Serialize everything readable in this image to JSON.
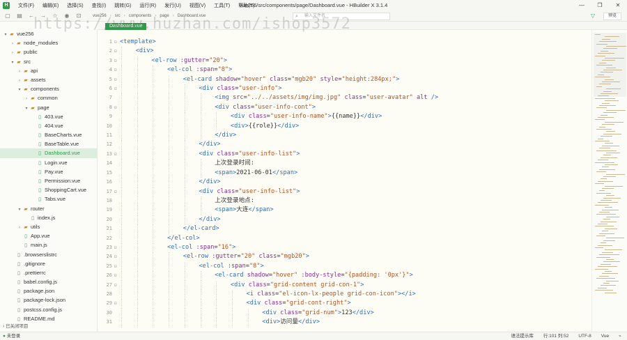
{
  "window": {
    "title": "vue256/src/components/page/Dashboard.vue - HBuilder X 3.1.4",
    "logo": "H",
    "controls": [
      "—",
      "❐",
      "✕"
    ]
  },
  "menu": [
    "文件(F)",
    "编辑(E)",
    "选择(S)",
    "查找(I)",
    "跳转(G)",
    "运行(R)",
    "发行(U)",
    "视图(V)",
    "工具(T)",
    "帮助(Y)"
  ],
  "toolbar": {
    "breadcrumbs": [
      "vue256",
      "src",
      "components",
      "page",
      "Dashboard.vue"
    ],
    "search_placeholder": "输入文件名",
    "preview_label": "预览"
  },
  "watermark": "https://www.huzhan.com/ishop3572",
  "sidebar": {
    "items": [
      {
        "label": "vue256",
        "type": "folder",
        "depth": 0,
        "open": true
      },
      {
        "label": "node_modules",
        "type": "folder",
        "depth": 1,
        "open": false
      },
      {
        "label": "public",
        "type": "folder",
        "depth": 1,
        "open": false
      },
      {
        "label": "src",
        "type": "folder",
        "depth": 1,
        "open": true
      },
      {
        "label": "api",
        "type": "folder",
        "depth": 2,
        "open": false
      },
      {
        "label": "assets",
        "type": "folder",
        "depth": 2,
        "open": false
      },
      {
        "label": "components",
        "type": "folder",
        "depth": 2,
        "open": true
      },
      {
        "label": "common",
        "type": "folder",
        "depth": 3,
        "open": false
      },
      {
        "label": "page",
        "type": "folder",
        "depth": 3,
        "open": true
      },
      {
        "label": "403.vue",
        "type": "vue",
        "depth": 4
      },
      {
        "label": "404.vue",
        "type": "vue",
        "depth": 4
      },
      {
        "label": "BaseCharts.vue",
        "type": "vue",
        "depth": 4
      },
      {
        "label": "BaseTable.vue",
        "type": "vue",
        "depth": 4
      },
      {
        "label": "Dashboard.vue",
        "type": "vue",
        "depth": 4,
        "selected": true
      },
      {
        "label": "Login.vue",
        "type": "vue",
        "depth": 4
      },
      {
        "label": "Pay.vue",
        "type": "vue",
        "depth": 4
      },
      {
        "label": "Permission.vue",
        "type": "vue",
        "depth": 4
      },
      {
        "label": "ShoppingCart.vue",
        "type": "vue",
        "depth": 4
      },
      {
        "label": "Tabs.vue",
        "type": "vue",
        "depth": 4
      },
      {
        "label": "router",
        "type": "folder",
        "depth": 2,
        "open": true
      },
      {
        "label": "index.js",
        "type": "file",
        "depth": 3
      },
      {
        "label": "utils",
        "type": "folder",
        "depth": 2,
        "open": false
      },
      {
        "label": "App.vue",
        "type": "vue",
        "depth": 2
      },
      {
        "label": "main.js",
        "type": "file",
        "depth": 2
      },
      {
        "label": ".browserslistrc",
        "type": "file",
        "depth": 1
      },
      {
        "label": ".gitignore",
        "type": "file",
        "depth": 1
      },
      {
        "label": ".prettierrc",
        "type": "file",
        "depth": 1
      },
      {
        "label": "babel.config.js",
        "type": "file",
        "depth": 1
      },
      {
        "label": "package.json",
        "type": "file",
        "depth": 1
      },
      {
        "label": "package-lock.json",
        "type": "file",
        "depth": 1
      },
      {
        "label": "postcss.config.js",
        "type": "file",
        "depth": 1
      },
      {
        "label": "README.md",
        "type": "file",
        "depth": 1
      }
    ],
    "footer": "已关闭项目"
  },
  "editor": {
    "tab_label": "Dashboard.vue",
    "lines": [
      {
        "n": 1,
        "fold": true,
        "indent": 0,
        "parts": [
          [
            "tg",
            "<template>"
          ]
        ]
      },
      {
        "n": 2,
        "fold": true,
        "indent": 1,
        "parts": [
          [
            "tg",
            "<div>"
          ]
        ]
      },
      {
        "n": 3,
        "fold": true,
        "indent": 2,
        "parts": [
          [
            "tg",
            "<el-row "
          ],
          [
            "at",
            ":gutter"
          ],
          [
            "tx",
            "="
          ],
          [
            "st",
            "\"20\""
          ],
          [
            "tg",
            ">"
          ]
        ]
      },
      {
        "n": 4,
        "fold": true,
        "indent": 3,
        "parts": [
          [
            "tg",
            "<el-col "
          ],
          [
            "at",
            ":span"
          ],
          [
            "tx",
            "="
          ],
          [
            "st",
            "\"8\""
          ],
          [
            "tg",
            ">"
          ]
        ]
      },
      {
        "n": 5,
        "fold": true,
        "indent": 4,
        "parts": [
          [
            "tg",
            "<el-card "
          ],
          [
            "at",
            "shadow"
          ],
          [
            "tx",
            "="
          ],
          [
            "st",
            "\"hover\""
          ],
          [
            "at",
            " class"
          ],
          [
            "tx",
            "="
          ],
          [
            "st",
            "\"mgb20\""
          ],
          [
            "at",
            " style"
          ],
          [
            "tx",
            "="
          ],
          [
            "st",
            "\"height:284px;\""
          ],
          [
            "tg",
            ">"
          ]
        ]
      },
      {
        "n": 6,
        "fold": true,
        "indent": 5,
        "parts": [
          [
            "tg",
            "<div "
          ],
          [
            "at",
            "class"
          ],
          [
            "tx",
            "="
          ],
          [
            "st",
            "\"user-info\""
          ],
          [
            "tg",
            ">"
          ]
        ]
      },
      {
        "n": 7,
        "fold": false,
        "indent": 6,
        "parts": [
          [
            "tg",
            "<img "
          ],
          [
            "at",
            "src"
          ],
          [
            "tx",
            "="
          ],
          [
            "st",
            "\"../../assets/img/img.jpg\""
          ],
          [
            "at",
            " class"
          ],
          [
            "tx",
            "="
          ],
          [
            "st",
            "\"user-avatar\""
          ],
          [
            "at",
            " alt"
          ],
          [
            "tg",
            " />"
          ]
        ]
      },
      {
        "n": 8,
        "fold": true,
        "indent": 6,
        "parts": [
          [
            "tg",
            "<div "
          ],
          [
            "at",
            "class"
          ],
          [
            "tx",
            "="
          ],
          [
            "st",
            "\"user-info-cont\""
          ],
          [
            "tg",
            ">"
          ]
        ]
      },
      {
        "n": 9,
        "fold": false,
        "indent": 7,
        "parts": [
          [
            "tg",
            "<div "
          ],
          [
            "at",
            "class"
          ],
          [
            "tx",
            "="
          ],
          [
            "st",
            "\"user-info-name\""
          ],
          [
            "tg",
            ">"
          ],
          [
            "tx",
            "{{name}}"
          ],
          [
            "tg",
            "</div>"
          ]
        ]
      },
      {
        "n": 10,
        "fold": false,
        "indent": 7,
        "parts": [
          [
            "tg",
            "<div>"
          ],
          [
            "tx",
            "{{role}}"
          ],
          [
            "tg",
            "</div>"
          ]
        ]
      },
      {
        "n": 11,
        "fold": false,
        "indent": 6,
        "parts": [
          [
            "tg",
            "</div>"
          ]
        ]
      },
      {
        "n": 12,
        "fold": false,
        "indent": 5,
        "parts": [
          [
            "tg",
            "</div>"
          ]
        ]
      },
      {
        "n": 13,
        "fold": true,
        "indent": 5,
        "parts": [
          [
            "tg",
            "<div "
          ],
          [
            "at",
            "class"
          ],
          [
            "tx",
            "="
          ],
          [
            "st",
            "\"user-info-list\""
          ],
          [
            "tg",
            ">"
          ]
        ]
      },
      {
        "n": 14,
        "fold": false,
        "indent": 6,
        "parts": [
          [
            "tx",
            "上次登录时间:"
          ]
        ]
      },
      {
        "n": 15,
        "fold": false,
        "indent": 6,
        "parts": [
          [
            "tg",
            "<span>"
          ],
          [
            "tx",
            "2021-06-01"
          ],
          [
            "tg",
            "</span>"
          ]
        ]
      },
      {
        "n": 16,
        "fold": false,
        "indent": 5,
        "parts": [
          [
            "tg",
            "</div>"
          ]
        ]
      },
      {
        "n": 17,
        "fold": true,
        "indent": 5,
        "parts": [
          [
            "tg",
            "<div "
          ],
          [
            "at",
            "class"
          ],
          [
            "tx",
            "="
          ],
          [
            "st",
            "\"user-info-list\""
          ],
          [
            "tg",
            ">"
          ]
        ]
      },
      {
        "n": 18,
        "fold": false,
        "indent": 6,
        "parts": [
          [
            "tx",
            "上次登录地点:"
          ]
        ]
      },
      {
        "n": 19,
        "fold": false,
        "indent": 6,
        "parts": [
          [
            "tg",
            "<span>"
          ],
          [
            "tx",
            "大连"
          ],
          [
            "tg",
            "</span>"
          ]
        ]
      },
      {
        "n": 20,
        "fold": false,
        "indent": 5,
        "parts": [
          [
            "tg",
            "</div>"
          ]
        ]
      },
      {
        "n": 21,
        "fold": false,
        "indent": 4,
        "parts": [
          [
            "tg",
            "</el-card>"
          ]
        ]
      },
      {
        "n": 22,
        "fold": false,
        "indent": 3,
        "parts": [
          [
            "tg",
            "</el-col>"
          ]
        ]
      },
      {
        "n": 23,
        "fold": true,
        "indent": 3,
        "parts": [
          [
            "tg",
            "<el-col "
          ],
          [
            "at",
            ":span"
          ],
          [
            "tx",
            "="
          ],
          [
            "st",
            "\"16\""
          ],
          [
            "tg",
            ">"
          ]
        ]
      },
      {
        "n": 24,
        "fold": true,
        "indent": 4,
        "parts": [
          [
            "tg",
            "<el-row "
          ],
          [
            "at",
            ":gutter"
          ],
          [
            "tx",
            "="
          ],
          [
            "st",
            "\"20\""
          ],
          [
            "at",
            " class"
          ],
          [
            "tx",
            "="
          ],
          [
            "st",
            "\"mgb20\""
          ],
          [
            "tg",
            ">"
          ]
        ]
      },
      {
        "n": 25,
        "fold": true,
        "indent": 5,
        "parts": [
          [
            "tg",
            "<el-col "
          ],
          [
            "at",
            ":span"
          ],
          [
            "tx",
            "="
          ],
          [
            "st",
            "\"8\""
          ],
          [
            "tg",
            ">"
          ]
        ]
      },
      {
        "n": 26,
        "fold": true,
        "indent": 6,
        "parts": [
          [
            "tg",
            "<el-card "
          ],
          [
            "at",
            "shadow"
          ],
          [
            "tx",
            "="
          ],
          [
            "st",
            "\"hover\""
          ],
          [
            "at",
            " :body-style"
          ],
          [
            "tx",
            "="
          ],
          [
            "st",
            "\"{padding: '0px'}\""
          ],
          [
            "tg",
            ">"
          ]
        ]
      },
      {
        "n": 27,
        "fold": true,
        "indent": 7,
        "parts": [
          [
            "tg",
            "<div "
          ],
          [
            "at",
            "class"
          ],
          [
            "tx",
            "="
          ],
          [
            "st",
            "\"grid-content grid-con-1\""
          ],
          [
            "tg",
            ">"
          ]
        ]
      },
      {
        "n": 28,
        "fold": false,
        "indent": 8,
        "parts": [
          [
            "tg",
            "<i "
          ],
          [
            "at",
            "class"
          ],
          [
            "tx",
            "="
          ],
          [
            "st",
            "\"el-icon-lx-people grid-con-icon\""
          ],
          [
            "tg",
            "></i>"
          ]
        ]
      },
      {
        "n": 29,
        "fold": true,
        "indent": 8,
        "parts": [
          [
            "tg",
            "<div "
          ],
          [
            "at",
            "class"
          ],
          [
            "tx",
            "="
          ],
          [
            "st",
            "\"grid-cont-right\""
          ],
          [
            "tg",
            ">"
          ]
        ]
      },
      {
        "n": 30,
        "fold": false,
        "indent": 9,
        "parts": [
          [
            "tg",
            "<div "
          ],
          [
            "at",
            "class"
          ],
          [
            "tx",
            "="
          ],
          [
            "st",
            "\"grid-num\""
          ],
          [
            "tg",
            ">"
          ],
          [
            "tx",
            "123"
          ],
          [
            "tg",
            "</div>"
          ]
        ]
      },
      {
        "n": 31,
        "fold": false,
        "indent": 9,
        "parts": [
          [
            "tg",
            "<div>"
          ],
          [
            "tx",
            "访问量"
          ],
          [
            "tg",
            "</div>"
          ]
        ]
      }
    ]
  },
  "statusbar": {
    "login": "未登录",
    "hint": "语法提示库",
    "position": "行:101  列:52",
    "encoding": "UTF-8",
    "language": "Vue"
  }
}
